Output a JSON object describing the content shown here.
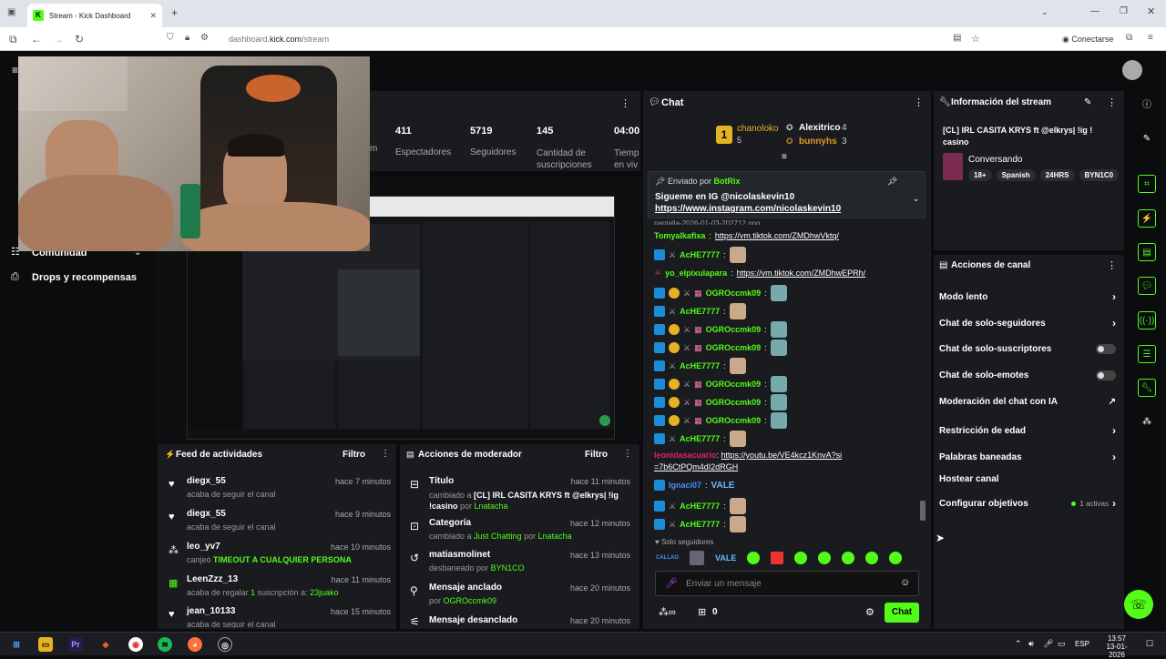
{
  "browser": {
    "tab_title": "Stream - Kick Dashboard",
    "url_prefix": "dashboard.",
    "url_host": "kick.com",
    "url_path": "/stream",
    "connect_label": "Conectarse"
  },
  "sidebar": {
    "community_label": "Comunidad",
    "drops_label": "Drops y recompensas"
  },
  "stats": [
    {
      "value": "411",
      "label": "Espectadores"
    },
    {
      "value": "5719",
      "label": "Seguidores"
    },
    {
      "value": "145",
      "label": "Cantidad de suscripciones"
    },
    {
      "value": "04:00:",
      "label": "Tiemp en viv"
    }
  ],
  "stats_partial_label": "m",
  "chat": {
    "title": "Chat",
    "leaders": [
      {
        "name": "chanoloko",
        "count": "5"
      },
      {
        "name": "Alexitrico",
        "count": "4"
      },
      {
        "name": "bunnyhs",
        "count": "3"
      }
    ],
    "pinned": {
      "sent_by_label": "Enviado por",
      "sender": "BotRix",
      "text": "Sigueme en IG ",
      "handle": "@nicolaskevin10 ",
      "link": "https://www.instagram.com/nicolaskevin10"
    },
    "partial_top": "pantalla-2026-01-03-202712.png",
    "messages": [
      {
        "user": "Tomyalkafixa",
        "text": "https://vm.tiktok.com/ZMDhwVktq/",
        "color": "#53fc18",
        "link": true
      },
      {
        "user": "AcHE7777",
        "text": "",
        "color": "#53fc18",
        "emote": true
      },
      {
        "user": "yo_elpixulapara",
        "text": "https://vm.tiktok.com/ZMDhwEPRh/",
        "color": "#53fc18",
        "link": true
      },
      {
        "user": "OGROccmk09",
        "text": "",
        "color": "#53fc18",
        "emote": true
      },
      {
        "user": "AcHE7777",
        "text": "",
        "color": "#53fc18",
        "emote": true
      },
      {
        "user": "OGROccmk09",
        "text": "",
        "color": "#53fc18",
        "emote": true
      },
      {
        "user": "OGROccmk09",
        "text": "",
        "color": "#53fc18",
        "emote": true
      },
      {
        "user": "AcHE7777",
        "text": "",
        "color": "#53fc18",
        "emote": true
      },
      {
        "user": "OGROccmk09",
        "text": "",
        "color": "#53fc18",
        "emote": true
      },
      {
        "user": "OGROccmk09",
        "text": "",
        "color": "#53fc18",
        "emote": true
      },
      {
        "user": "OGROccmk09",
        "text": "",
        "color": "#53fc18",
        "emote": true
      },
      {
        "user": "AcHE7777",
        "text": "",
        "color": "#53fc18",
        "emote": true
      }
    ],
    "link_msg": {
      "user": "leonidasacuario",
      "text": "https://youtu.be/VE4kcz1KnvA?si=7b6CtPQm4dI2dRGH"
    },
    "ignacio": {
      "user": "Ignaci07",
      "text": "VALE"
    },
    "after": [
      {
        "user": "AcHE7777"
      },
      {
        "user": "AcHE7777"
      }
    ],
    "followers_only": "Solo seguidores",
    "input_placeholder": "Enviar un mensaje",
    "count": "0",
    "send_label": "Chat"
  },
  "stream_info": {
    "title": "Información del stream",
    "stream_title": "[CL] IRL CASITA KRYS ft @elkrys| !ig ! casino",
    "category": "Conversando",
    "tags": [
      "18+",
      "Spanish",
      "24HRS",
      "BYN1C0"
    ]
  },
  "channel_actions": {
    "title": "Acciones de canal",
    "items": [
      {
        "label": "Modo lento",
        "kind": "chevron"
      },
      {
        "label": "Chat de solo-seguidores",
        "kind": "chevron"
      },
      {
        "label": "Chat de solo-suscriptores",
        "kind": "toggle"
      },
      {
        "label": "Chat de solo-emotes",
        "kind": "toggle"
      },
      {
        "label": "Moderación del chat con IA",
        "kind": "external"
      },
      {
        "label": "Restricción de edad",
        "kind": "chevron"
      },
      {
        "label": "Palabras baneadas",
        "kind": "chevron"
      },
      {
        "label": "Hostear canal",
        "kind": "none"
      },
      {
        "label": "Configurar objetivos",
        "kind": "chevron",
        "extra": "1 activas"
      }
    ]
  },
  "feed": {
    "title": "Feed de actividades",
    "filter": "Filtro",
    "items": [
      {
        "user": "diegx_55",
        "time": "hace 7 minutos",
        "desc": "acaba de seguir el canal"
      },
      {
        "user": "diegx_55",
        "time": "hace 9 minutos",
        "desc": "acaba de seguir el canal"
      },
      {
        "user": "leo_yv7",
        "time": "hace 10 minutos",
        "desc_pre": "canjeó ",
        "desc_hi": "TIMEOUT A CUALQUIER PERSONA"
      },
      {
        "user": "LeenZzz_13",
        "time": "hace 11 minutos",
        "desc_pre": "acaba de regalar ",
        "desc_num": "1",
        "desc_mid": " suscripción a: ",
        "desc_hi": "23juako"
      },
      {
        "user": "jean_10133",
        "time": "hace 15 minutos",
        "desc": "acaba de seguir el canal"
      }
    ]
  },
  "mod": {
    "title": "Acciones de moderador",
    "filter": "Filtro",
    "items": [
      {
        "title": "Título",
        "time": "hace 11 minutos",
        "pre": "cambiado a ",
        "val": "[CL] IRL CASITA KRYS ft @elkrys| !ig !casino",
        "by": " por ",
        "who": "Lnatacha"
      },
      {
        "title": "Categoría",
        "time": "hace 12 minutos",
        "pre": "cambiado a ",
        "val": "Just Chatting",
        "by": " por ",
        "who": "Lnatacha"
      },
      {
        "title": "matiasmolinet",
        "time": "hace 13 minutos",
        "pre": "desbaneado por ",
        "val": "",
        "by": "",
        "who": "BYN1CO"
      },
      {
        "title": "Mensaje anclado",
        "time": "hace 20 minutos",
        "pre": "por ",
        "val": "",
        "by": "",
        "who": "OGROccmk09"
      },
      {
        "title": "Mensaje desanclado",
        "time": "hace 20 minutos",
        "pre": "",
        "val": "",
        "by": "",
        "who": ""
      }
    ]
  },
  "taskbar": {
    "lang": "ESP",
    "time": "13:57",
    "date": "13-01-2026"
  },
  "colors": {
    "accent": "#53fc18",
    "panel": "#191b1f",
    "bg": "#0b0c0e"
  }
}
